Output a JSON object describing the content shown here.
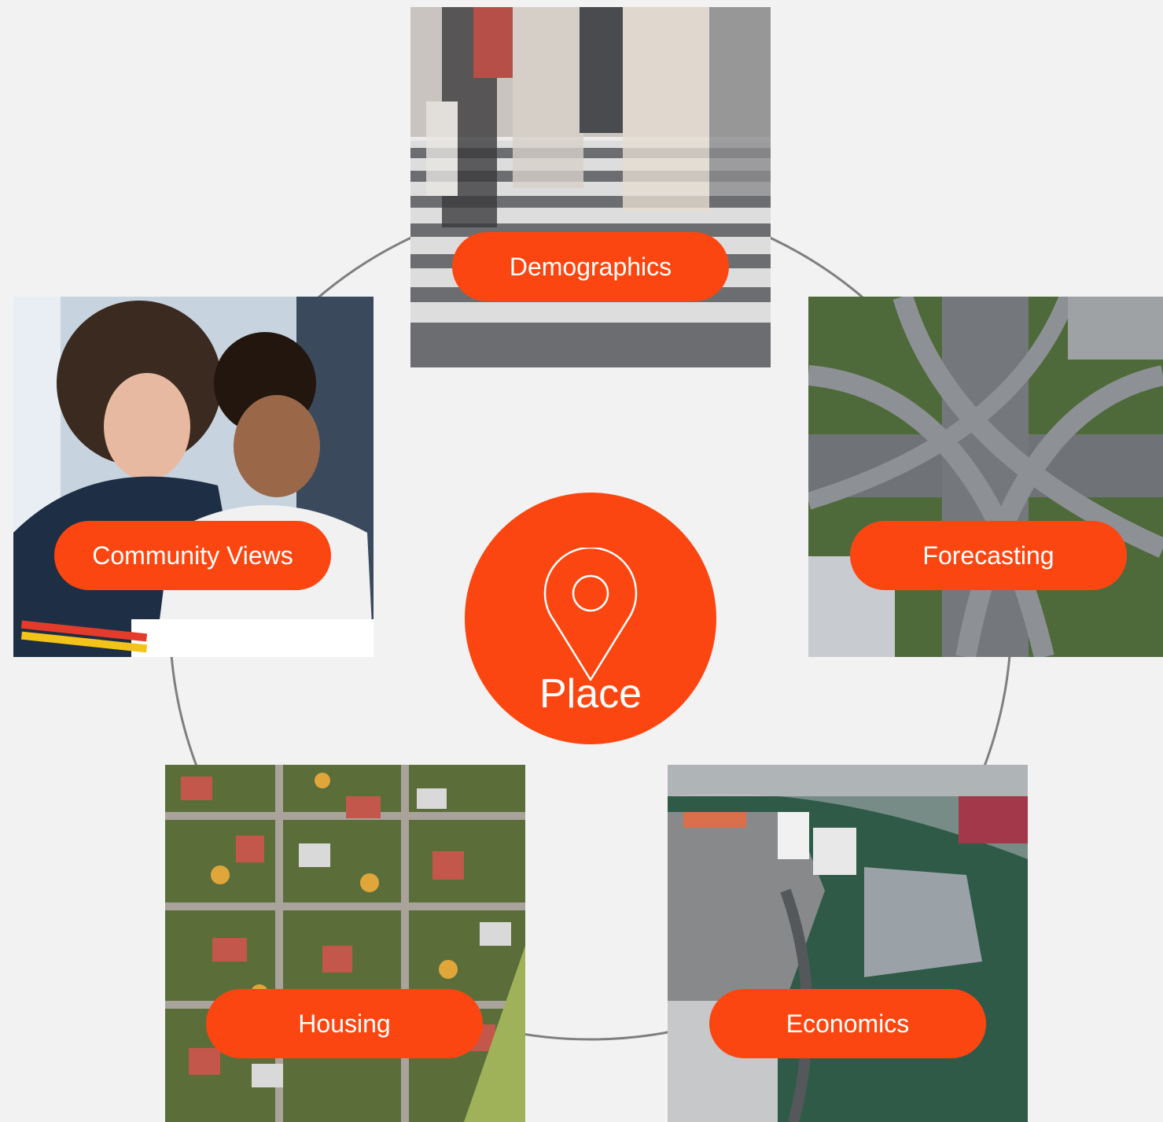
{
  "colors": {
    "accent": "#fc4611",
    "background": "#f2f2f2",
    "ring": "#7f7f7f",
    "label_text": "#ffffff"
  },
  "hub": {
    "label": "Place",
    "icon": "location-pin-icon"
  },
  "topics": [
    {
      "label": "Demographics",
      "photo": "blurred pedestrians on a zebra crossing"
    },
    {
      "label": "Community Views",
      "photo": "mother and son drawing with pencils"
    },
    {
      "label": "Forecasting",
      "photo": "aerial view of a highway interchange"
    },
    {
      "label": "Housing",
      "photo": "aerial view of a suburban neighbourhood"
    },
    {
      "label": "Economics",
      "photo": "aerial view of waterfront buildings"
    }
  ]
}
